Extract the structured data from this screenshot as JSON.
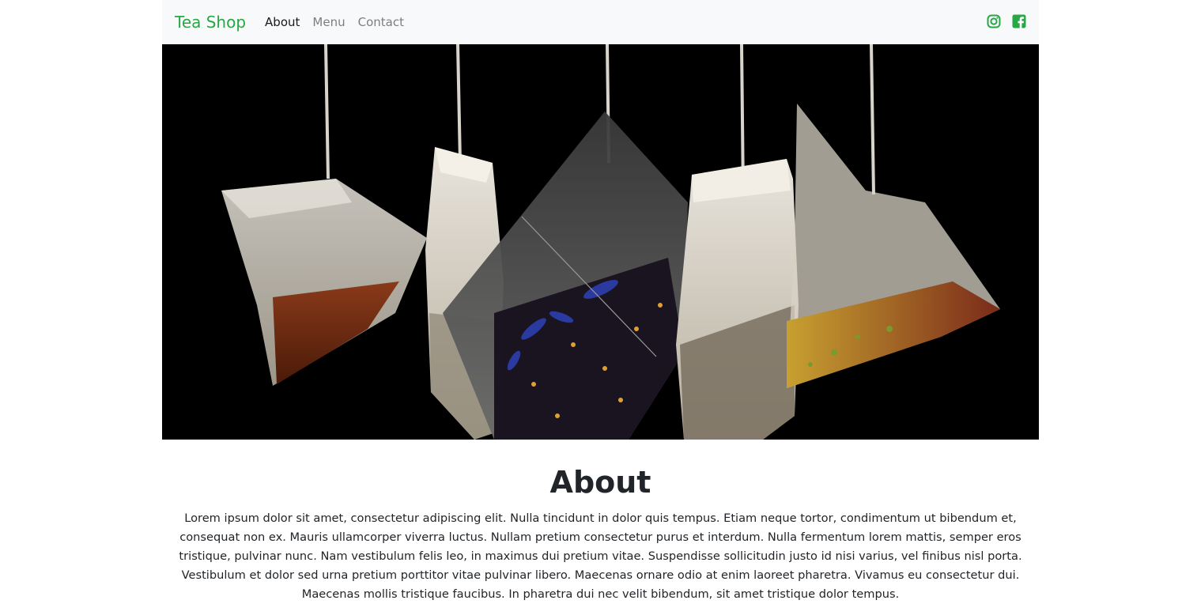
{
  "navbar": {
    "brand": "Tea Shop",
    "links": [
      {
        "label": "About",
        "active": true
      },
      {
        "label": "Menu",
        "active": false
      },
      {
        "label": "Contact",
        "active": false
      }
    ],
    "social_icons": [
      "instagram-icon",
      "facebook-icon"
    ]
  },
  "hero": {
    "image": "hanging-tea-bags-photo"
  },
  "about": {
    "title": "About",
    "body": "Lorem ipsum dolor sit amet, consectetur adipiscing elit. Nulla tincidunt in dolor quis tempus. Etiam neque tortor, condimentum ut bibendum et, consequat non ex. Mauris ullamcorper viverra luctus. Nullam pretium consectetur purus et interdum. Nulla fermentum lorem mattis, semper eros tristique, pulvinar nunc. Nam vestibulum felis leo, in maximus dui pretium vitae. Suspendisse sollicitudin justo id nisi varius, vel finibus nisl porta. Vestibulum et dolor sed urna pretium porttitor vitae pulvinar libero. Maecenas ornare odio at enim laoreet pharetra. Vivamus eu consectetur dui. Maecenas mollis tristique faucibus. In pharetra dui nec velit bibendum, sit amet tristique dolor tempus."
  },
  "colors": {
    "brand": "#28a745",
    "navbar_bg": "#f8f9fa",
    "hero_bg": "#000000"
  }
}
